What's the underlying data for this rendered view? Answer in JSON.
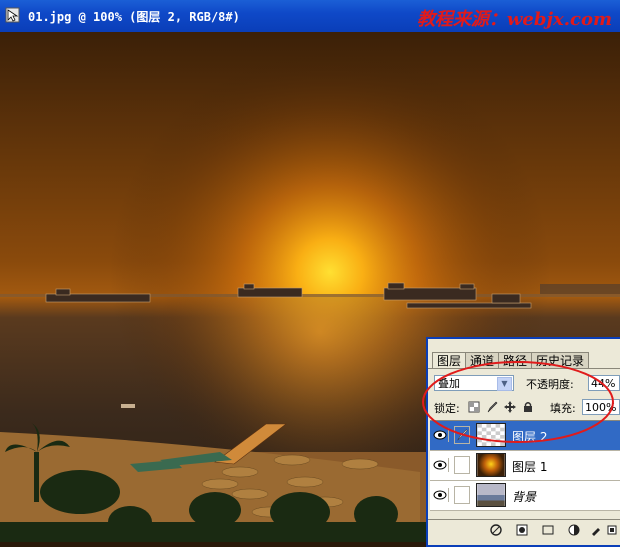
{
  "window": {
    "title": "01.jpg @ 100% (图层 2, RGB/8#)",
    "watermark": "教程来源：webjx.com",
    "icon": "photoshop-document-icon"
  },
  "layers_palette": {
    "tabs": [
      "图层",
      "通道",
      "路径",
      "历史记录"
    ],
    "active_tab": "图层",
    "blend_mode": "叠加",
    "opacity_label": "不透明度:",
    "opacity_value": "44%",
    "lock_label": "锁定:",
    "fill_label": "填充:",
    "fill_value": "100%",
    "layers": [
      {
        "name": "图层 2",
        "selected": true,
        "italic": false,
        "thumb": "transparent-checker"
      },
      {
        "name": "图层 1",
        "selected": false,
        "italic": false,
        "thumb": "sunset-glow"
      },
      {
        "name": "背景",
        "selected": false,
        "italic": true,
        "thumb": "harbor-photo"
      }
    ],
    "bottom_icons": [
      "link-icon",
      "layer-style-icon",
      "mask-icon",
      "new-set-icon",
      "adjustment-icon",
      "new-layer-icon"
    ]
  },
  "colors": {
    "titlebar": "#0f49c8",
    "selection": "#316ac5",
    "watermark": "#e11a1a",
    "annotation": "#e01b1b",
    "glow": "#ffd21a"
  }
}
